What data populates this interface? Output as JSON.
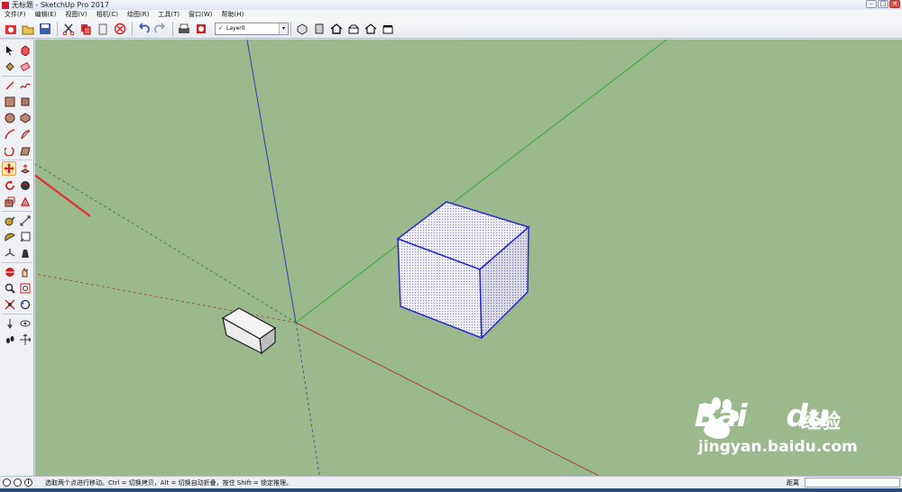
{
  "window": {
    "title": "无标题 - SketchUp Pro 2017",
    "controls": [
      "–",
      "□",
      "✕"
    ]
  },
  "menu": {
    "items": [
      "文件(F)",
      "编辑(E)",
      "视图(V)",
      "相机(C)",
      "绘图(R)",
      "工具(T)",
      "窗口(W)",
      "帮助(H)"
    ]
  },
  "toolbar": {
    "layer_check": "✓",
    "layer_value": "Layer0",
    "layer_dropdown_icon": "▾"
  },
  "status": {
    "hint": "选取两个点进行移动。Ctrl = 切换拷贝，Alt = 切换自动折叠，按住 Shift = 锁定推理。",
    "measure_label": "距离",
    "measure_value": "",
    "info_icon_glyph": "i"
  },
  "watermark": {
    "brand": "Bai",
    "brand_suffix": "du",
    "brand_cn": "经验",
    "url": "jingyan.baidu.com"
  },
  "colors": {
    "viewport_bg": "#9ab98c",
    "selection_blue": "#2a2ad0",
    "axis_red": "#b04030",
    "axis_green": "#38a838",
    "axis_blue": "#3040b0",
    "arrow_red": "#e03030"
  },
  "icons": {
    "toolbar": [
      "getting-started-icon",
      "open-icon",
      "save-icon",
      "cut-icon",
      "copy-icon",
      "paste-icon",
      "erase-icon",
      "undo-icon",
      "redo-icon",
      "print-icon",
      "model-info-icon",
      "iso-view-icon",
      "top-view-icon",
      "front-view-icon",
      "right-view-icon",
      "back-view-icon",
      "left-view-icon"
    ],
    "palette": [
      "select-icon",
      "make-component-icon",
      "paint-bucket-icon",
      "eraser-icon",
      "line-icon",
      "freehand-icon",
      "rectangle-icon",
      "rotated-rectangle-icon",
      "circle-icon",
      "polygon-icon",
      "arc-icon",
      "pie-icon",
      "two-point-arc-icon",
      "three-point-arc-icon",
      "move-icon",
      "push-pull-icon",
      "rotate-icon",
      "follow-me-icon",
      "scale-icon",
      "offset-icon",
      "tape-measure-icon",
      "dimension-icon",
      "protractor-icon",
      "text-icon",
      "axes-icon",
      "3d-text-icon",
      "orbit-icon",
      "pan-icon",
      "zoom-icon",
      "zoom-window-icon",
      "zoom-extents-icon",
      "previous-view-icon",
      "position-camera-icon",
      "look-around-icon",
      "walk-icon",
      "section-plane-icon"
    ]
  }
}
